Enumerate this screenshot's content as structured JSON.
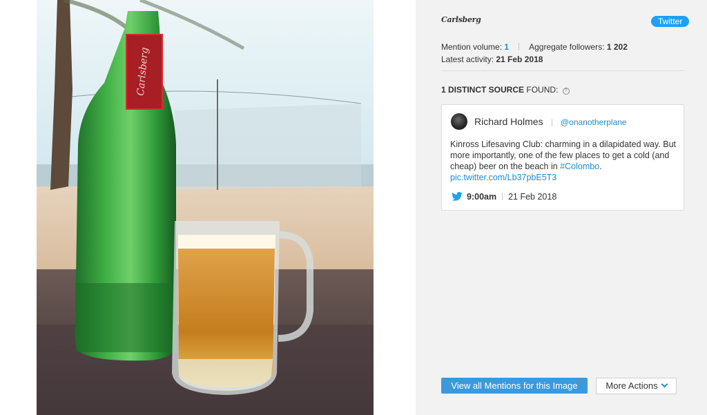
{
  "panel": {
    "brand_logo_text": "Carlsberg",
    "network_badge": "Twitter",
    "mention_volume_label": "Mention volume:",
    "mention_volume_value": "1",
    "followers_label": "Aggregate followers:",
    "followers_value": "1 202",
    "latest_activity_label": "Latest activity:",
    "latest_activity_value": "21 Feb 2018",
    "sources_count_text": "1 DISTINCT SOURCE",
    "sources_suffix": "FOUND:",
    "info_icon": "info-icon"
  },
  "tweet": {
    "author_name": "Richard Holmes",
    "author_handle": "@onanotherplane",
    "text_part1": "Kinross Lifesaving Club: charming in a dilapidated way. But more importantly, one of the few places to get a cold (and cheap) beer on the beach in ",
    "hashtag": "#Colombo",
    "text_part2": ".",
    "link": "pic.twitter.com/Lb37pbE5T3",
    "time": "9:00am",
    "date": "21 Feb 2018",
    "network_icon": "twitter-bird-icon"
  },
  "actions": {
    "view_all_label": "View all Mentions for this Image",
    "more_actions_label": "More Actions"
  },
  "image": {
    "detected_logo_label": "Carlsberg"
  },
  "colors": {
    "accent": "#1da1f2",
    "link": "#1f8bd6",
    "button": "#3c99dc",
    "detection_box": "#e0282e"
  }
}
